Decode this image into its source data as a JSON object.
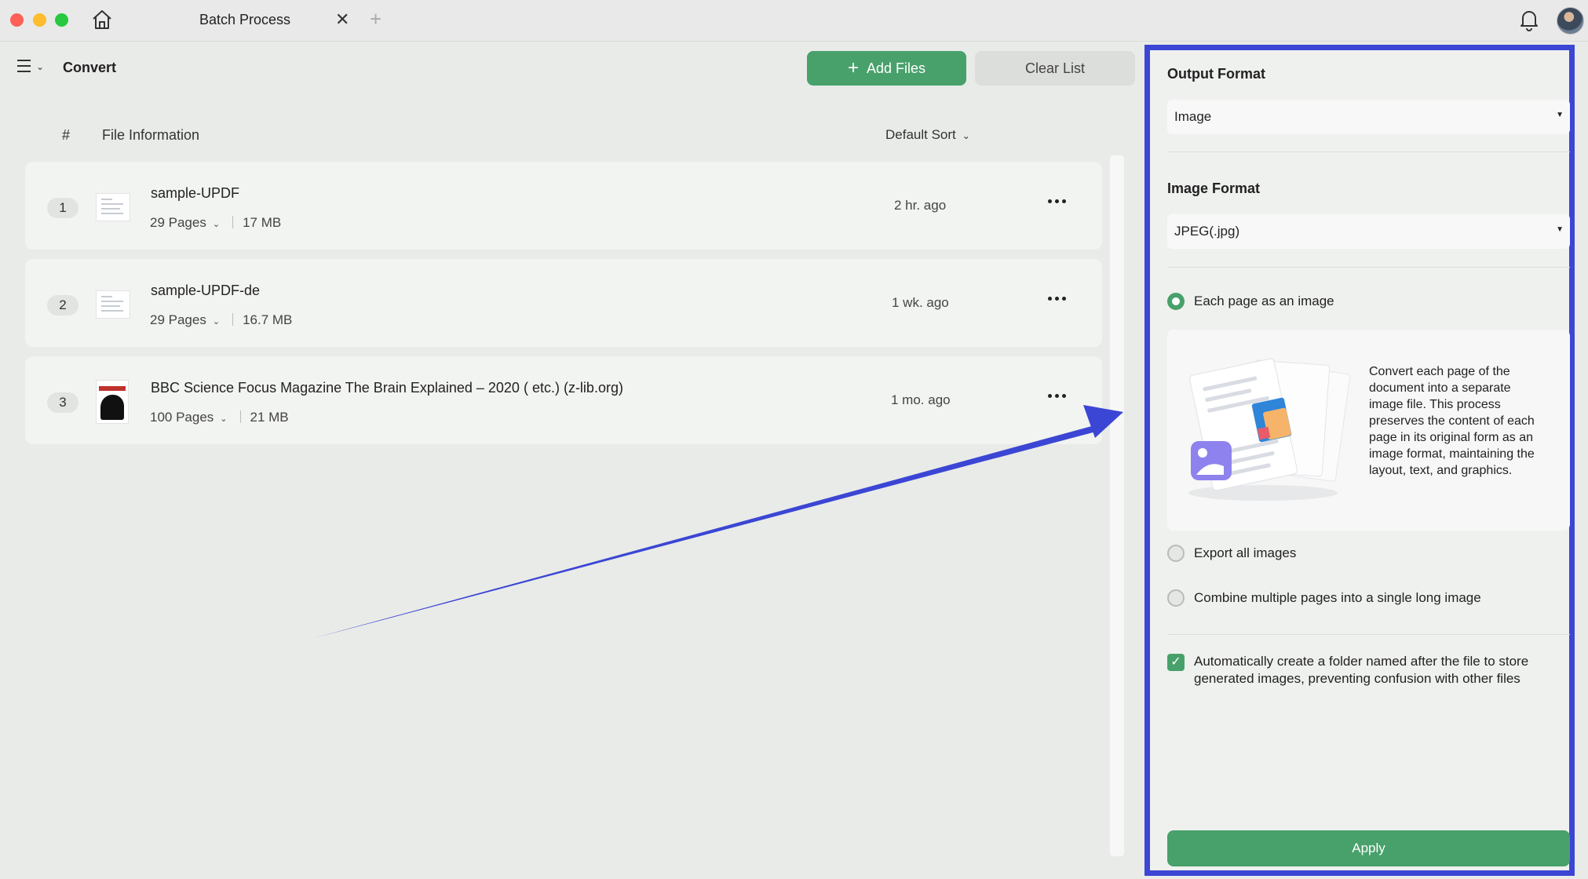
{
  "titlebar": {
    "tab_title": "Batch Process",
    "close_glyph": "✕",
    "add_glyph": "+"
  },
  "toolbar": {
    "title": "Convert",
    "add_files_label": "Add Files",
    "clear_list_label": "Clear List"
  },
  "list_header": {
    "index": "#",
    "file_information": "File Information",
    "sort": "Default Sort"
  },
  "files": [
    {
      "index": "1",
      "name": "sample-UPDF",
      "pages": "29 Pages",
      "size": "17 MB",
      "time": "2 hr. ago"
    },
    {
      "index": "2",
      "name": "sample-UPDF-de",
      "pages": "29 Pages",
      "size": "16.7 MB",
      "time": "1 wk. ago"
    },
    {
      "index": "3",
      "name": "BBC Science Focus Magazine The Brain Explained – 2020 ( etc.) (z-lib.org)",
      "pages": "100 Pages",
      "size": "21 MB",
      "time": "1 mo. ago"
    }
  ],
  "panel": {
    "output_format_heading": "Output Format",
    "output_format_value": "Image",
    "image_format_heading": "Image Format",
    "image_format_value": "JPEG(.jpg)",
    "options": [
      {
        "label": "Each page as an image",
        "selected": true
      },
      {
        "label": "Export all images",
        "selected": false
      },
      {
        "label": "Combine multiple pages into a single long image",
        "selected": false
      }
    ],
    "description": "Convert each page of the document into a separate image file. This process preserves the content of each page in its original form as an image format, maintaining the layout, text, and graphics.",
    "auto_folder_label": "Automatically create a folder named after the file to store generated images, preventing confusion with other files",
    "auto_folder_checked": true,
    "apply_label": "Apply"
  },
  "colors": {
    "accent_green": "#48a06a",
    "annotation_blue": "#3b46d4"
  },
  "icons": {
    "home": "home-icon",
    "bell": "bell-icon",
    "menu": "menu-icon",
    "more": "more-icon"
  }
}
